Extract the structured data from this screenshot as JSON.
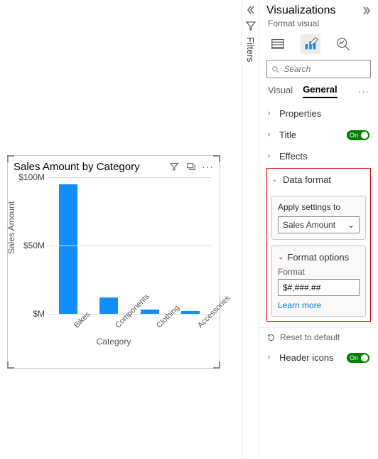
{
  "filters_rail": {
    "label": "Filters"
  },
  "visual": {
    "title": "Sales Amount by Category"
  },
  "chart_data": {
    "type": "bar",
    "title": "Sales Amount by Category",
    "xlabel": "Category",
    "ylabel": "Sales Amount",
    "ylim": [
      0,
      100
    ],
    "yticks": [
      {
        "v": 100,
        "label": "$100M"
      },
      {
        "v": 50,
        "label": "$50M"
      },
      {
        "v": 0,
        "label": "$M"
      }
    ],
    "categories": [
      "Bikes",
      "Components",
      "Clothing",
      "Accessories"
    ],
    "values": [
      95,
      12,
      3,
      2
    ]
  },
  "pane": {
    "title": "Visualizations",
    "subtitle": "Format visual",
    "search_placeholder": "Search",
    "tabs": {
      "visual": "Visual",
      "general": "General"
    },
    "sections": {
      "properties": "Properties",
      "title": "Title",
      "effects": "Effects",
      "data_format": "Data format",
      "header_icons": "Header icons"
    },
    "apply_label": "Apply settings to",
    "apply_value": "Sales Amount",
    "format_options": "Format options",
    "format_label": "Format",
    "format_value": "$#,###.##",
    "learn_more": "Learn more",
    "reset": "Reset to default",
    "toggle_on": "On"
  }
}
